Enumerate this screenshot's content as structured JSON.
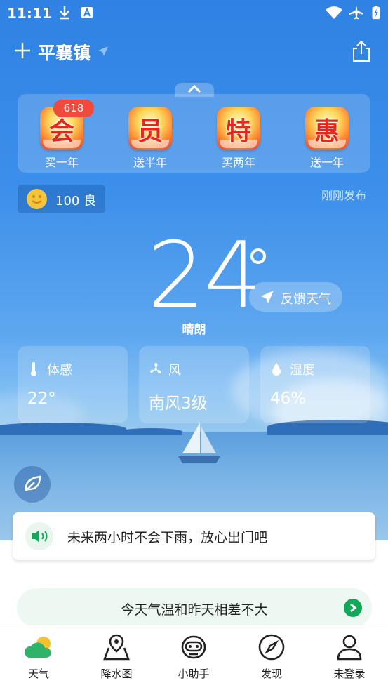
{
  "status_bar": {
    "time": "11:11"
  },
  "header": {
    "location": "平襄镇"
  },
  "promo": {
    "badge": "618",
    "items": [
      {
        "char": "会",
        "label": "买一年"
      },
      {
        "char": "员",
        "label": "送半年"
      },
      {
        "char": "特",
        "label": "买两年"
      },
      {
        "char": "惠",
        "label": "送一年"
      }
    ]
  },
  "air_quality": {
    "text": "100 良"
  },
  "published": "刚刚发布",
  "current": {
    "temperature": "24",
    "condition": "晴朗",
    "feedback_label": "反馈天气"
  },
  "metrics": [
    {
      "label": "体感",
      "value": "22°"
    },
    {
      "label": "风",
      "value": "南风3级"
    },
    {
      "label": "湿度",
      "value": "46%"
    }
  ],
  "rain_notice": "未来两小时不会下雨，放心出门吧",
  "temp_diff": "今天气温和昨天相差不大",
  "tabs": [
    {
      "label": "天气"
    },
    {
      "label": "降水图"
    },
    {
      "label": "小助手"
    },
    {
      "label": "发现"
    },
    {
      "label": "未登录"
    }
  ],
  "colors": {
    "sky_top": "#2f82e3",
    "accent_green": "#12a85a",
    "promo_red": "#f04a3c"
  }
}
